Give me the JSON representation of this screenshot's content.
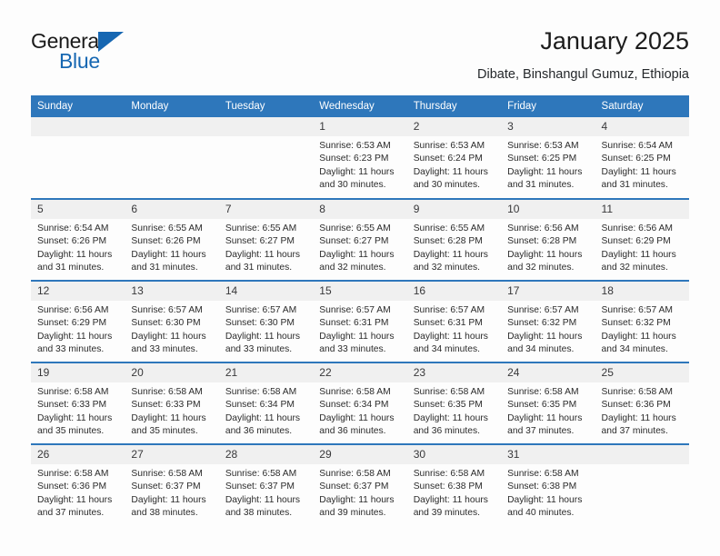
{
  "brand": {
    "name_top": "General",
    "name_bottom": "Blue",
    "triangle_icon": "blue-triangle-icon",
    "accent_color": "#1667b2"
  },
  "header": {
    "title": "January 2025",
    "subtitle": "Dibate, Binshangul Gumuz, Ethiopia"
  },
  "colors": {
    "header_row_bg": "#2e77bb",
    "header_row_text": "#ffffff",
    "daynum_strip_bg": "#f0f0f0",
    "row_divider": "#2e77bb",
    "cell_bg": "#fdfdfd",
    "body_text": "#2b2b2b"
  },
  "calendar": {
    "weekday_headers": [
      "Sunday",
      "Monday",
      "Tuesday",
      "Wednesday",
      "Thursday",
      "Friday",
      "Saturday"
    ],
    "labels": {
      "sunrise": "Sunrise:",
      "sunset": "Sunset:",
      "daylight": "Daylight:"
    },
    "weeks": [
      [
        {
          "day": ""
        },
        {
          "day": ""
        },
        {
          "day": ""
        },
        {
          "day": "1",
          "sunrise": "Sunrise: 6:53 AM",
          "sunset": "Sunset: 6:23 PM",
          "daylight": "Daylight: 11 hours and 30 minutes."
        },
        {
          "day": "2",
          "sunrise": "Sunrise: 6:53 AM",
          "sunset": "Sunset: 6:24 PM",
          "daylight": "Daylight: 11 hours and 30 minutes."
        },
        {
          "day": "3",
          "sunrise": "Sunrise: 6:53 AM",
          "sunset": "Sunset: 6:25 PM",
          "daylight": "Daylight: 11 hours and 31 minutes."
        },
        {
          "day": "4",
          "sunrise": "Sunrise: 6:54 AM",
          "sunset": "Sunset: 6:25 PM",
          "daylight": "Daylight: 11 hours and 31 minutes."
        }
      ],
      [
        {
          "day": "5",
          "sunrise": "Sunrise: 6:54 AM",
          "sunset": "Sunset: 6:26 PM",
          "daylight": "Daylight: 11 hours and 31 minutes."
        },
        {
          "day": "6",
          "sunrise": "Sunrise: 6:55 AM",
          "sunset": "Sunset: 6:26 PM",
          "daylight": "Daylight: 11 hours and 31 minutes."
        },
        {
          "day": "7",
          "sunrise": "Sunrise: 6:55 AM",
          "sunset": "Sunset: 6:27 PM",
          "daylight": "Daylight: 11 hours and 31 minutes."
        },
        {
          "day": "8",
          "sunrise": "Sunrise: 6:55 AM",
          "sunset": "Sunset: 6:27 PM",
          "daylight": "Daylight: 11 hours and 32 minutes."
        },
        {
          "day": "9",
          "sunrise": "Sunrise: 6:55 AM",
          "sunset": "Sunset: 6:28 PM",
          "daylight": "Daylight: 11 hours and 32 minutes."
        },
        {
          "day": "10",
          "sunrise": "Sunrise: 6:56 AM",
          "sunset": "Sunset: 6:28 PM",
          "daylight": "Daylight: 11 hours and 32 minutes."
        },
        {
          "day": "11",
          "sunrise": "Sunrise: 6:56 AM",
          "sunset": "Sunset: 6:29 PM",
          "daylight": "Daylight: 11 hours and 32 minutes."
        }
      ],
      [
        {
          "day": "12",
          "sunrise": "Sunrise: 6:56 AM",
          "sunset": "Sunset: 6:29 PM",
          "daylight": "Daylight: 11 hours and 33 minutes."
        },
        {
          "day": "13",
          "sunrise": "Sunrise: 6:57 AM",
          "sunset": "Sunset: 6:30 PM",
          "daylight": "Daylight: 11 hours and 33 minutes."
        },
        {
          "day": "14",
          "sunrise": "Sunrise: 6:57 AM",
          "sunset": "Sunset: 6:30 PM",
          "daylight": "Daylight: 11 hours and 33 minutes."
        },
        {
          "day": "15",
          "sunrise": "Sunrise: 6:57 AM",
          "sunset": "Sunset: 6:31 PM",
          "daylight": "Daylight: 11 hours and 33 minutes."
        },
        {
          "day": "16",
          "sunrise": "Sunrise: 6:57 AM",
          "sunset": "Sunset: 6:31 PM",
          "daylight": "Daylight: 11 hours and 34 minutes."
        },
        {
          "day": "17",
          "sunrise": "Sunrise: 6:57 AM",
          "sunset": "Sunset: 6:32 PM",
          "daylight": "Daylight: 11 hours and 34 minutes."
        },
        {
          "day": "18",
          "sunrise": "Sunrise: 6:57 AM",
          "sunset": "Sunset: 6:32 PM",
          "daylight": "Daylight: 11 hours and 34 minutes."
        }
      ],
      [
        {
          "day": "19",
          "sunrise": "Sunrise: 6:58 AM",
          "sunset": "Sunset: 6:33 PM",
          "daylight": "Daylight: 11 hours and 35 minutes."
        },
        {
          "day": "20",
          "sunrise": "Sunrise: 6:58 AM",
          "sunset": "Sunset: 6:33 PM",
          "daylight": "Daylight: 11 hours and 35 minutes."
        },
        {
          "day": "21",
          "sunrise": "Sunrise: 6:58 AM",
          "sunset": "Sunset: 6:34 PM",
          "daylight": "Daylight: 11 hours and 36 minutes."
        },
        {
          "day": "22",
          "sunrise": "Sunrise: 6:58 AM",
          "sunset": "Sunset: 6:34 PM",
          "daylight": "Daylight: 11 hours and 36 minutes."
        },
        {
          "day": "23",
          "sunrise": "Sunrise: 6:58 AM",
          "sunset": "Sunset: 6:35 PM",
          "daylight": "Daylight: 11 hours and 36 minutes."
        },
        {
          "day": "24",
          "sunrise": "Sunrise: 6:58 AM",
          "sunset": "Sunset: 6:35 PM",
          "daylight": "Daylight: 11 hours and 37 minutes."
        },
        {
          "day": "25",
          "sunrise": "Sunrise: 6:58 AM",
          "sunset": "Sunset: 6:36 PM",
          "daylight": "Daylight: 11 hours and 37 minutes."
        }
      ],
      [
        {
          "day": "26",
          "sunrise": "Sunrise: 6:58 AM",
          "sunset": "Sunset: 6:36 PM",
          "daylight": "Daylight: 11 hours and 37 minutes."
        },
        {
          "day": "27",
          "sunrise": "Sunrise: 6:58 AM",
          "sunset": "Sunset: 6:37 PM",
          "daylight": "Daylight: 11 hours and 38 minutes."
        },
        {
          "day": "28",
          "sunrise": "Sunrise: 6:58 AM",
          "sunset": "Sunset: 6:37 PM",
          "daylight": "Daylight: 11 hours and 38 minutes."
        },
        {
          "day": "29",
          "sunrise": "Sunrise: 6:58 AM",
          "sunset": "Sunset: 6:37 PM",
          "daylight": "Daylight: 11 hours and 39 minutes."
        },
        {
          "day": "30",
          "sunrise": "Sunrise: 6:58 AM",
          "sunset": "Sunset: 6:38 PM",
          "daylight": "Daylight: 11 hours and 39 minutes."
        },
        {
          "day": "31",
          "sunrise": "Sunrise: 6:58 AM",
          "sunset": "Sunset: 6:38 PM",
          "daylight": "Daylight: 11 hours and 40 minutes."
        },
        {
          "day": ""
        }
      ]
    ]
  }
}
